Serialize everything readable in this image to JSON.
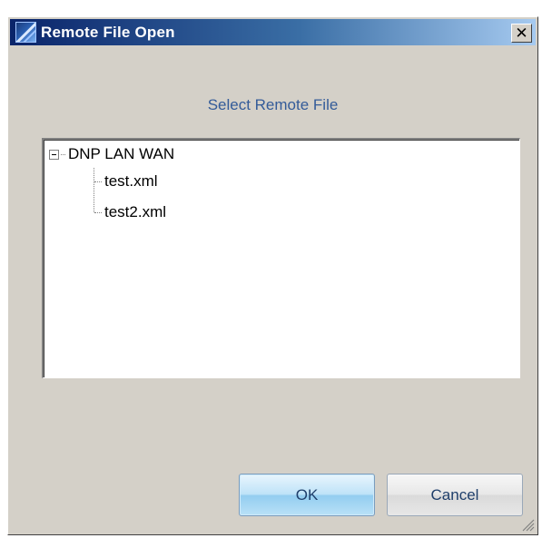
{
  "window": {
    "title": "Remote File Open",
    "close_glyph": "✕",
    "icon": "app-icon"
  },
  "dialog": {
    "heading": "Select Remote File"
  },
  "tree": {
    "root_label": "DNP LAN WAN",
    "root_expanded": true,
    "children": [
      "test.xml",
      "test2.xml"
    ]
  },
  "buttons": {
    "ok_label": "OK",
    "cancel_label": "Cancel"
  },
  "colors": {
    "title_gradient_start": "#0a246a",
    "title_gradient_end": "#a6caf0",
    "heading_text": "#335b99",
    "dialog_bg": "#d4d0c8"
  }
}
